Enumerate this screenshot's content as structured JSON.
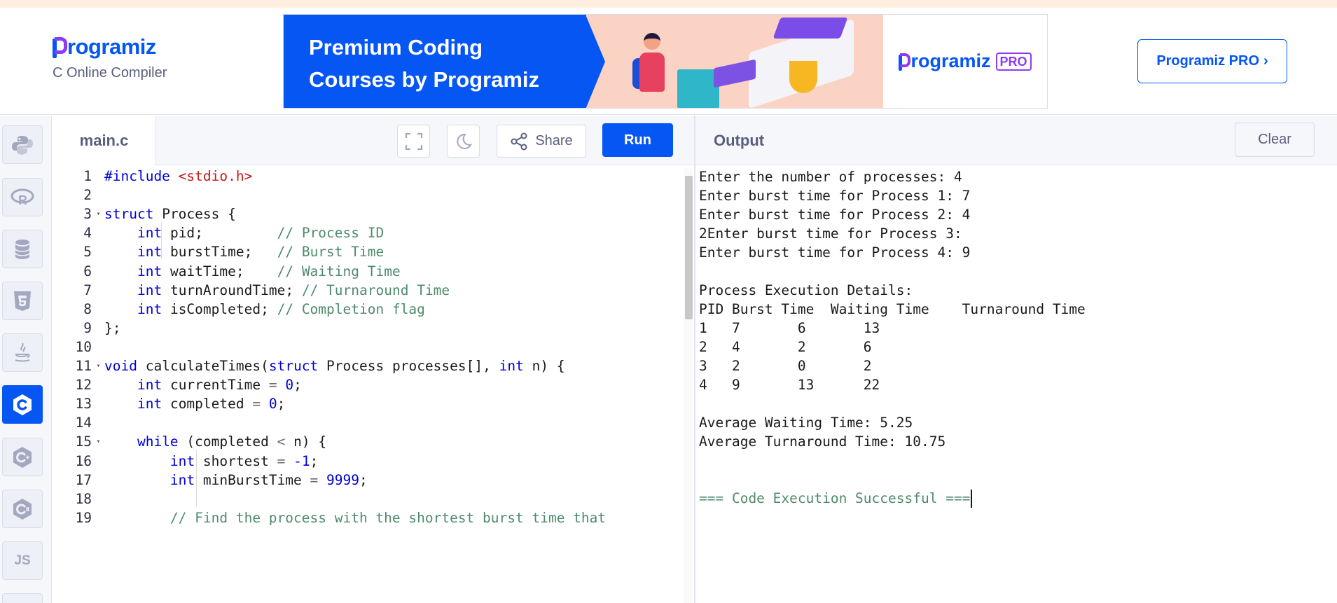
{
  "brand": {
    "logo_text": "rogramiz",
    "subtitle": "C Online Compiler"
  },
  "ad": {
    "headline_line1": "Premium Coding",
    "headline_line2": "Courses by Programiz",
    "logo_text": "rogramiz",
    "logo_badge": "PRO"
  },
  "header": {
    "pro_button_label": "Programiz PRO",
    "pro_button_chevron": "›"
  },
  "sidebar": {
    "items": [
      {
        "name": "python-icon",
        "label": ""
      },
      {
        "name": "r-icon",
        "label": ""
      },
      {
        "name": "database-icon",
        "label": ""
      },
      {
        "name": "html5-icon",
        "label": ""
      },
      {
        "name": "java-icon",
        "label": ""
      },
      {
        "name": "c-icon",
        "label": "",
        "active": true
      },
      {
        "name": "cpp-icon",
        "label": ""
      },
      {
        "name": "csharp-icon",
        "label": ""
      },
      {
        "name": "js-icon",
        "label": "JS"
      }
    ]
  },
  "editor": {
    "file_tab": "main.c",
    "share_label": "Share",
    "run_label": "Run",
    "lines": [
      {
        "n": "1",
        "fold": false,
        "code": "#include <stdio.h>"
      },
      {
        "n": "2",
        "fold": false,
        "code": ""
      },
      {
        "n": "3",
        "fold": true,
        "code": "struct Process {"
      },
      {
        "n": "4",
        "fold": false,
        "code": "    int pid;         // Process ID"
      },
      {
        "n": "5",
        "fold": false,
        "code": "    int burstTime;   // Burst Time"
      },
      {
        "n": "6",
        "fold": false,
        "code": "    int waitTime;    // Waiting Time"
      },
      {
        "n": "7",
        "fold": false,
        "code": "    int turnAroundTime; // Turnaround Time"
      },
      {
        "n": "8",
        "fold": false,
        "code": "    int isCompleted; // Completion flag"
      },
      {
        "n": "9",
        "fold": false,
        "code": "};"
      },
      {
        "n": "10",
        "fold": false,
        "code": ""
      },
      {
        "n": "11",
        "fold": true,
        "code": "void calculateTimes(struct Process processes[], int n) {"
      },
      {
        "n": "12",
        "fold": false,
        "code": "    int currentTime = 0;"
      },
      {
        "n": "13",
        "fold": false,
        "code": "    int completed = 0;"
      },
      {
        "n": "14",
        "fold": false,
        "code": ""
      },
      {
        "n": "15",
        "fold": true,
        "code": "    while (completed < n) {"
      },
      {
        "n": "16",
        "fold": false,
        "code": "        int shortest = -1;"
      },
      {
        "n": "17",
        "fold": false,
        "code": "        int minBurstTime = 9999;"
      },
      {
        "n": "18",
        "fold": false,
        "code": ""
      },
      {
        "n": "19",
        "fold": false,
        "code": "        // Find the process with the shortest burst time that"
      }
    ]
  },
  "output": {
    "title": "Output",
    "clear_label": "Clear",
    "lines": [
      "Enter the number of processes: 4",
      "Enter burst time for Process 1: 7",
      "Enter burst time for Process 2: 4",
      "2Enter burst time for Process 3: ",
      "Enter burst time for Process 4: 9",
      "",
      "Process Execution Details:",
      "PID Burst Time  Waiting Time    Turnaround Time",
      "1   7       6       13",
      "2   4       2       6",
      "3   2       0       2",
      "4   9       13      22",
      "",
      "Average Waiting Time: 5.25",
      "Average Turnaround Time: 10.75",
      "",
      "",
      "=== Code Execution Successful ==="
    ]
  },
  "colors": {
    "accent": "#0556f3",
    "brand_purple": "#8e3bf5",
    "keyword": "#0000d6",
    "string": "#c41a16",
    "comment": "#4f8a6d"
  }
}
